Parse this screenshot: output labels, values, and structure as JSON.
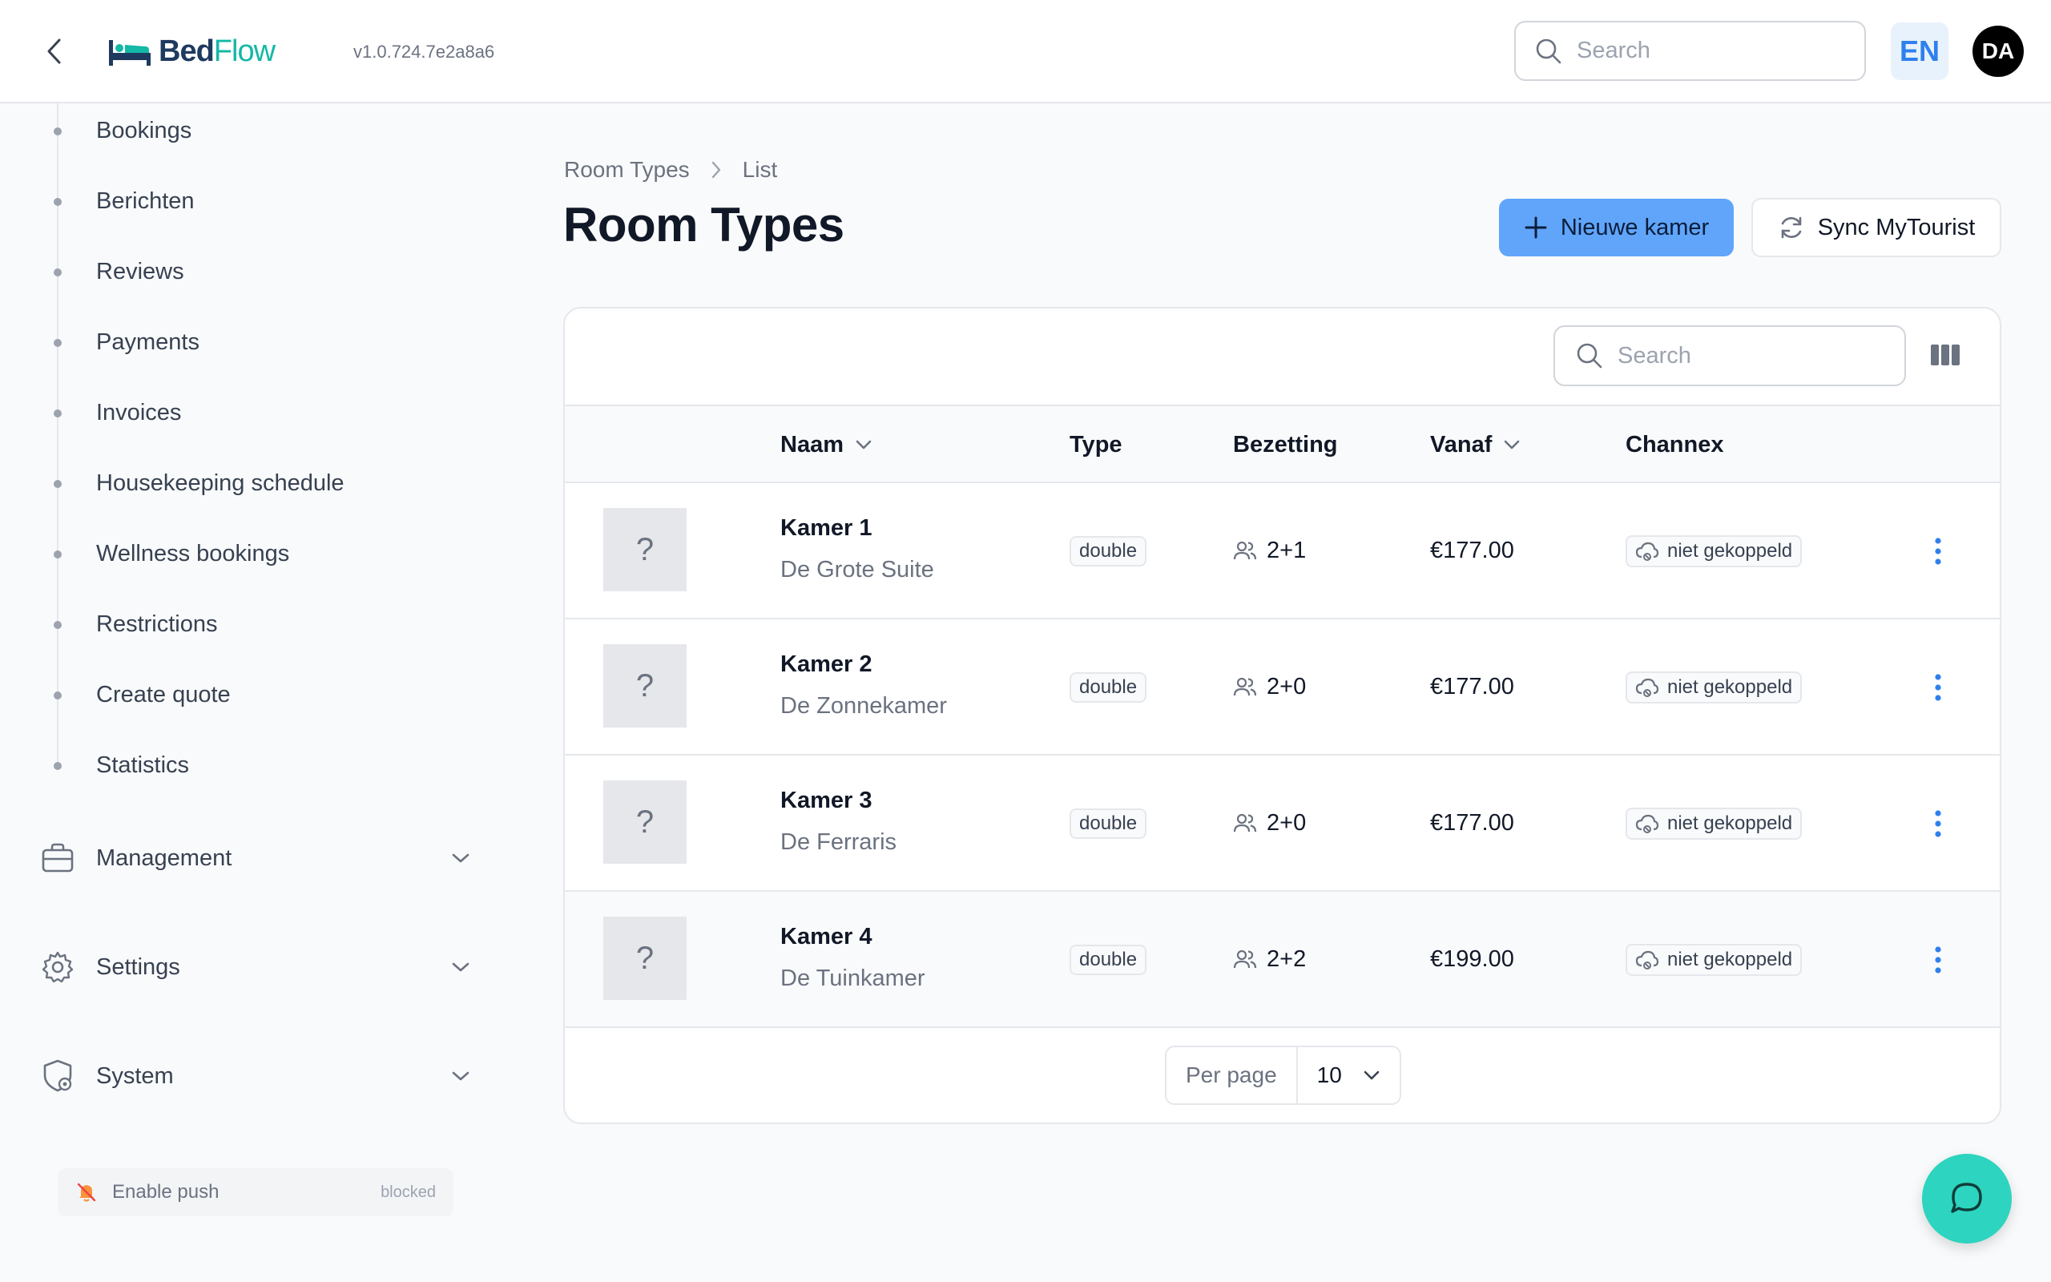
{
  "app": {
    "logo_part1": "Bed",
    "logo_part2": "Flow",
    "version": "v1.0.724.7e2a8a6"
  },
  "topbar": {
    "search_placeholder": "Search",
    "language": "EN",
    "avatar_initials": "DA"
  },
  "sidebar": {
    "items": [
      {
        "label": "Bookings"
      },
      {
        "label": "Berichten"
      },
      {
        "label": "Reviews"
      },
      {
        "label": "Payments"
      },
      {
        "label": "Invoices"
      },
      {
        "label": "Housekeeping schedule"
      },
      {
        "label": "Wellness bookings"
      },
      {
        "label": "Restrictions"
      },
      {
        "label": "Create quote"
      },
      {
        "label": "Statistics"
      }
    ],
    "groups": [
      {
        "label": "Management",
        "icon": "briefcase-icon"
      },
      {
        "label": "Settings",
        "icon": "gear-icon"
      },
      {
        "label": "System",
        "icon": "shield-gear-icon"
      }
    ],
    "push": {
      "label": "Enable push",
      "status": "blocked"
    }
  },
  "breadcrumb": {
    "parent": "Room Types",
    "current": "List"
  },
  "page": {
    "title": "Room Types",
    "new_room_label": "Nieuwe kamer",
    "sync_label": "Sync MyTourist"
  },
  "table": {
    "search_placeholder": "Search",
    "columns": {
      "name": "Naam",
      "type": "Type",
      "occupancy": "Bezetting",
      "from": "Vanaf",
      "channex": "Channex"
    },
    "rows": [
      {
        "thumb": "?",
        "name": "Kamer 1",
        "subtitle": "De Grote Suite",
        "type": "double",
        "occupancy": "2+1",
        "price": "€177.00",
        "channex": "niet gekoppeld"
      },
      {
        "thumb": "?",
        "name": "Kamer 2",
        "subtitle": "De Zonnekamer",
        "type": "double",
        "occupancy": "2+0",
        "price": "€177.00",
        "channex": "niet gekoppeld"
      },
      {
        "thumb": "?",
        "name": "Kamer 3",
        "subtitle": "De Ferraris",
        "type": "double",
        "occupancy": "2+0",
        "price": "€177.00",
        "channex": "niet gekoppeld"
      },
      {
        "thumb": "?",
        "name": "Kamer 4",
        "subtitle": "De Tuinkamer",
        "type": "double",
        "occupancy": "2+2",
        "price": "€199.00",
        "channex": "niet gekoppeld"
      }
    ],
    "pagination": {
      "per_page_label": "Per page",
      "per_page_value": "10"
    }
  },
  "colors": {
    "primary": "#60a5fa",
    "accent": "#14b8a6",
    "chat": "#2dd4bf"
  }
}
